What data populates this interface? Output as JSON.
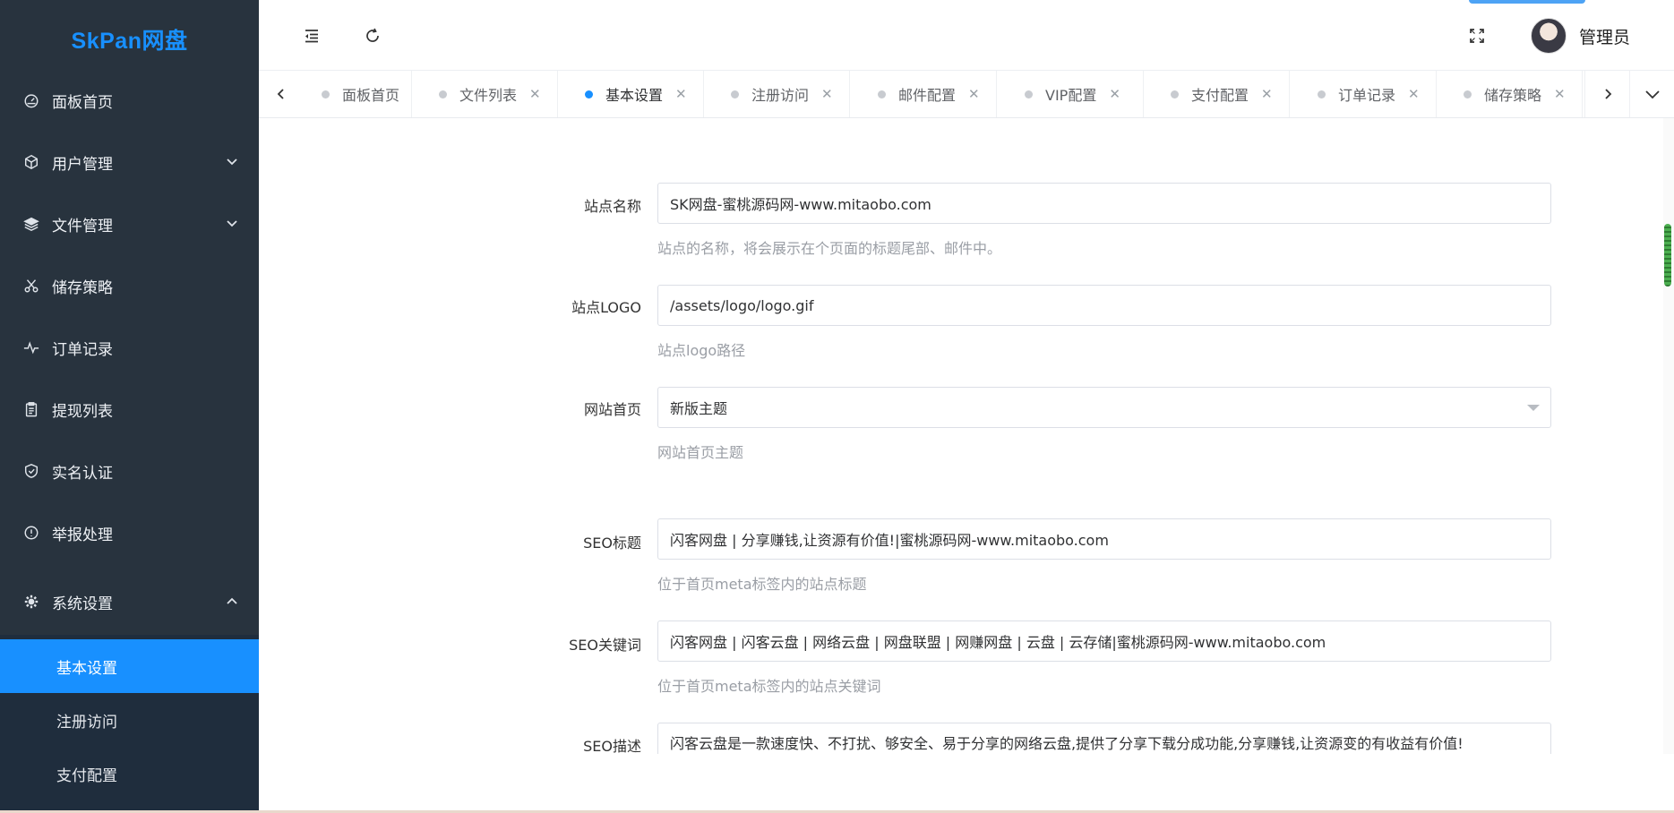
{
  "brand": {
    "title": "SkPan网盘"
  },
  "sidebar": {
    "items": [
      {
        "label": "面板首页",
        "icon": "dashboard-icon"
      },
      {
        "label": "用户管理",
        "icon": "cube-icon",
        "expandable": true
      },
      {
        "label": "文件管理",
        "icon": "layers-icon",
        "expandable": true
      },
      {
        "label": "储存策略",
        "icon": "scissors-icon"
      },
      {
        "label": "订单记录",
        "icon": "activity-icon"
      },
      {
        "label": "提现列表",
        "icon": "clipboard-icon"
      },
      {
        "label": "实名认证",
        "icon": "shield-check-icon"
      },
      {
        "label": "举报处理",
        "icon": "info-circle-icon"
      },
      {
        "label": "系统设置",
        "icon": "gear-icon",
        "expanded": true
      }
    ],
    "submenu": [
      {
        "label": "基本设置",
        "active": true
      },
      {
        "label": "注册访问"
      },
      {
        "label": "支付配置"
      }
    ]
  },
  "header": {
    "user_name": "管理员"
  },
  "tabs": [
    {
      "label": "面板首页",
      "closable": false
    },
    {
      "label": "文件列表",
      "closable": true
    },
    {
      "label": "基本设置",
      "closable": true,
      "active": true
    },
    {
      "label": "注册访问",
      "closable": true
    },
    {
      "label": "邮件配置",
      "closable": true
    },
    {
      "label": "VIP配置",
      "closable": true
    },
    {
      "label": "支付配置",
      "closable": true
    },
    {
      "label": "订单记录",
      "closable": true
    },
    {
      "label": "储存策略",
      "closable": true
    }
  ],
  "tab_close_glyph": "✕",
  "form": {
    "site_name": {
      "label": "站点名称",
      "value": "SK网盘-蜜桃源码网-www.mitaobo.com",
      "help": "站点的名称，将会展示在个页面的标题尾部、邮件中。"
    },
    "site_logo": {
      "label": "站点LOGO",
      "value": "/assets/logo/logo.gif",
      "help": "站点logo路径"
    },
    "homepage": {
      "label": "网站首页",
      "value": "新版主题",
      "help": "网站首页主题"
    },
    "seo_title": {
      "label": "SEO标题",
      "value": "闪客网盘 | 分享赚钱,让资源有价值!|蜜桃源码网-www.mitaobo.com",
      "help": "位于首页meta标签内的站点标题"
    },
    "seo_keywords": {
      "label": "SEO关键词",
      "value": "闪客网盘 | 闪客云盘 | 网络云盘 | 网盘联盟 | 网赚网盘 | 云盘 | 云存储|蜜桃源码网-www.mitaobo.com",
      "help": "位于首页meta标签内的站点关键词"
    },
    "seo_desc": {
      "label": "SEO描述",
      "value": "闪客云盘是一款速度快、不打扰、够安全、易于分享的网络云盘,提供了分享下载分成功能,分享赚钱,让资源变的有收益有价值!"
    }
  },
  "colors": {
    "sidebar_bg": "#28333e",
    "submenu_bg": "#1f2d3d",
    "accent": "#1890ff"
  }
}
